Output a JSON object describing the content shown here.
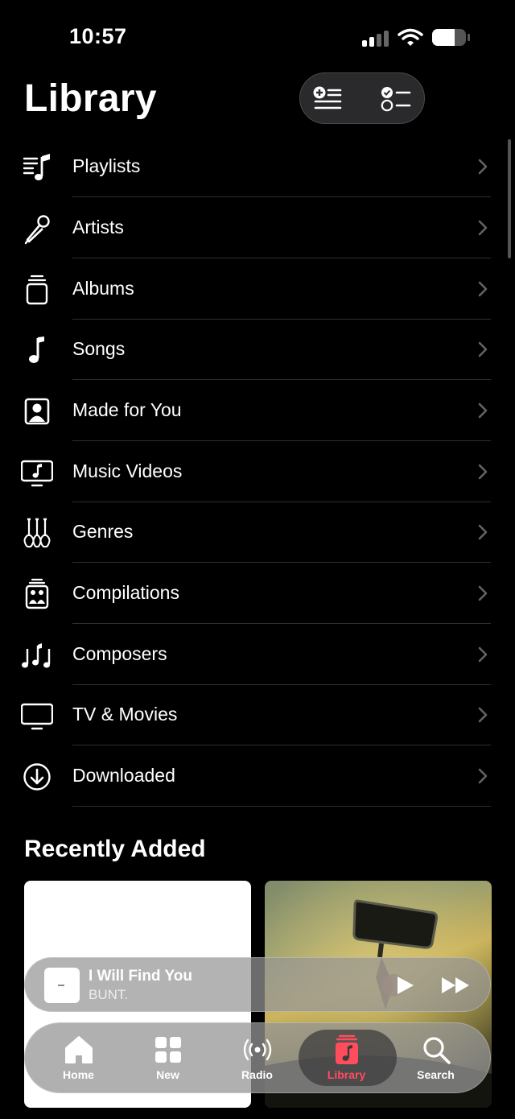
{
  "status_bar": {
    "time": "10:57"
  },
  "header": {
    "title": "Library"
  },
  "library_items": [
    {
      "label": "Playlists",
      "icon": "playlist-icon"
    },
    {
      "label": "Artists",
      "icon": "microphone-icon"
    },
    {
      "label": "Albums",
      "icon": "album-icon"
    },
    {
      "label": "Songs",
      "icon": "music-note-icon"
    },
    {
      "label": "Made for You",
      "icon": "person-square-icon"
    },
    {
      "label": "Music Videos",
      "icon": "music-video-icon"
    },
    {
      "label": "Genres",
      "icon": "guitars-icon"
    },
    {
      "label": "Compilations",
      "icon": "compilations-icon"
    },
    {
      "label": "Composers",
      "icon": "music-notes-icon"
    },
    {
      "label": "TV & Movies",
      "icon": "tv-icon"
    },
    {
      "label": "Downloaded",
      "icon": "download-icon"
    }
  ],
  "recently_added": {
    "title": "Recently Added"
  },
  "now_playing": {
    "title": "I Will Find You",
    "artist": "BUNT."
  },
  "tabs": [
    {
      "label": "Home",
      "icon": "home-icon"
    },
    {
      "label": "New",
      "icon": "grid-icon"
    },
    {
      "label": "Radio",
      "icon": "radio-icon"
    },
    {
      "label": "Library",
      "icon": "library-icon",
      "selected": true
    },
    {
      "label": "Search",
      "icon": "search-icon"
    }
  ],
  "colors": {
    "accent": "#ff4d5e",
    "background": "#000000",
    "separator": "#2e2e30"
  }
}
